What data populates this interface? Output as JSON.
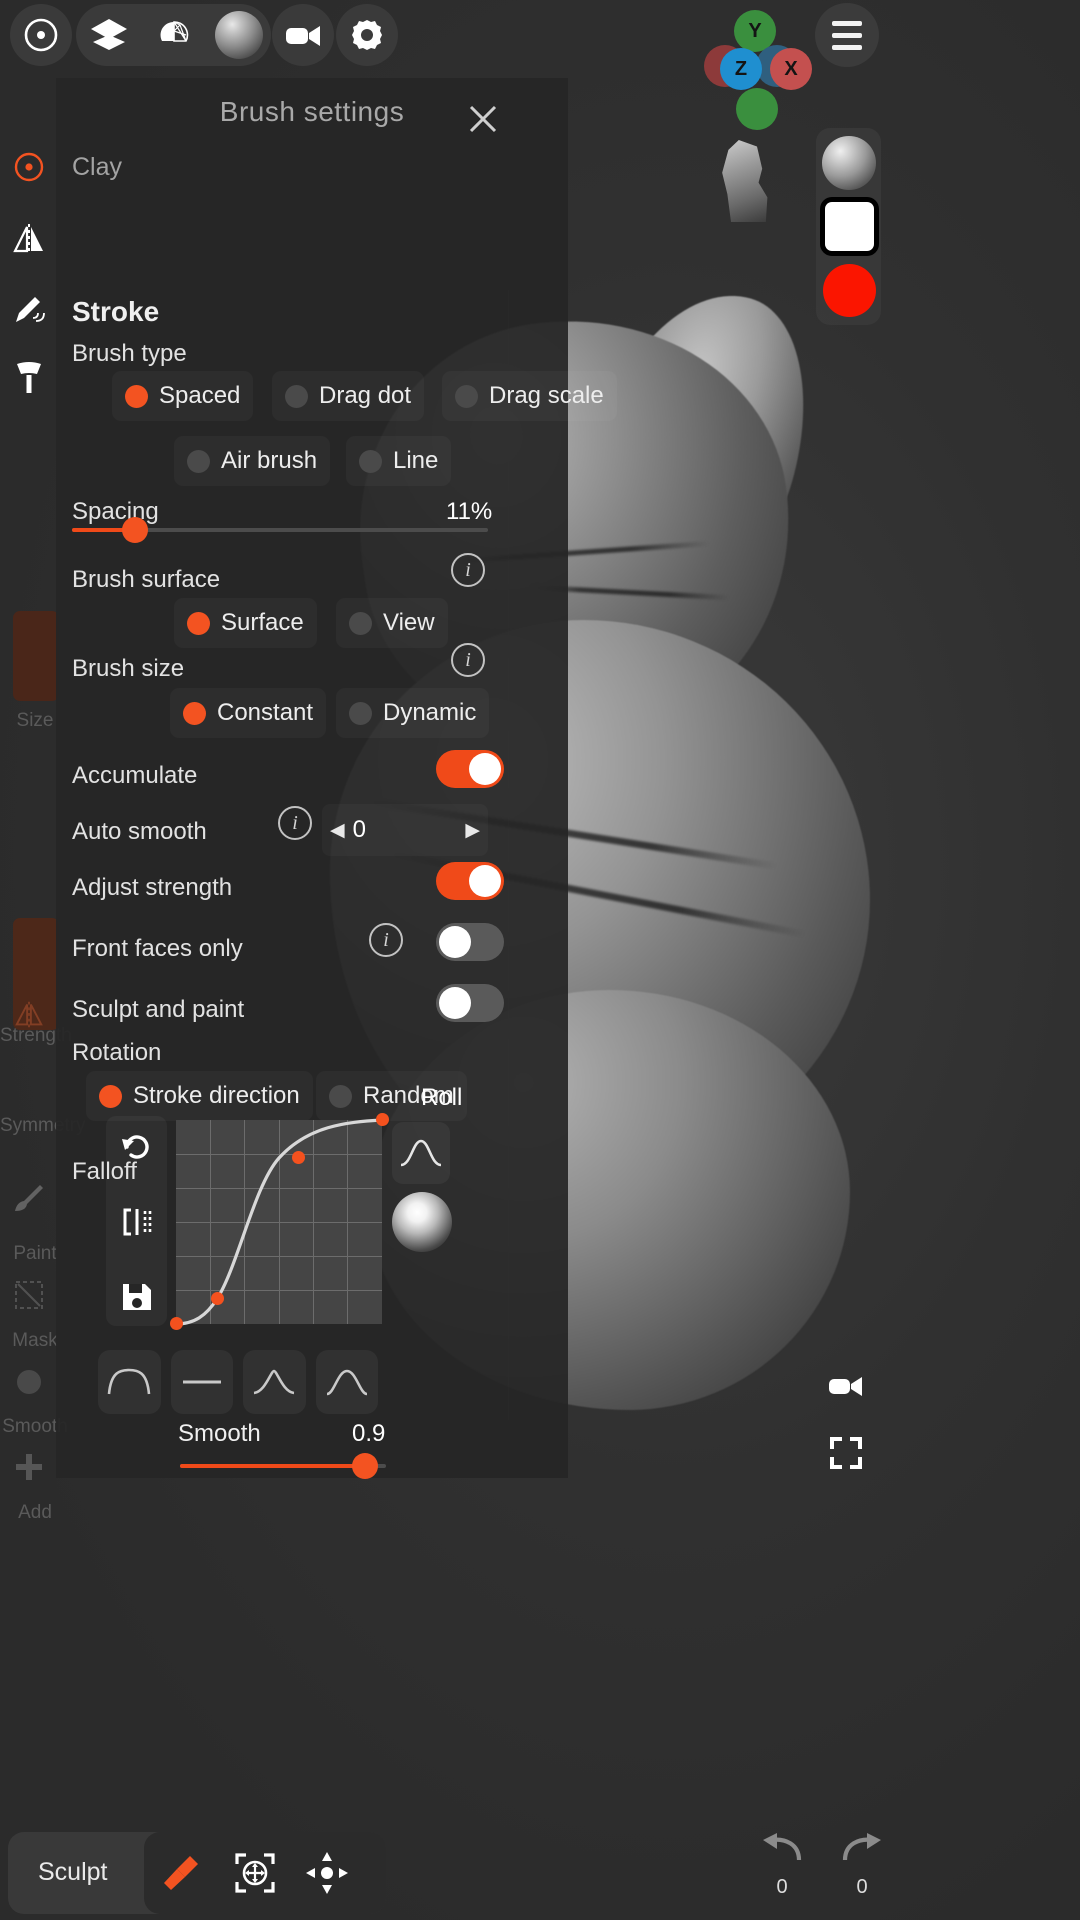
{
  "app": {
    "accent": "#f35321",
    "panel_bg": "#262626",
    "viewport_bg": "#2e2e2e"
  },
  "topbar": {
    "items": [
      {
        "name": "target-icon",
        "label": "Target"
      },
      {
        "name": "layers-icon",
        "label": "Layers"
      },
      {
        "name": "topology-icon",
        "label": "Topology"
      },
      {
        "name": "material-sphere-icon",
        "label": "Material"
      },
      {
        "name": "camera-icon",
        "label": "Camera"
      },
      {
        "name": "gear-icon",
        "label": "Settings"
      }
    ],
    "menu_label": "Menu"
  },
  "gizmo": {
    "axes": [
      {
        "label": "Y",
        "color": "#3a8f3e"
      },
      {
        "label": "Z",
        "color": "#1f8fd0"
      },
      {
        "label": "X",
        "color": "#c4504f"
      },
      {
        "label": "",
        "color": "#8d3a3a"
      },
      {
        "label": "",
        "color": "#2f5f7f"
      },
      {
        "label": "",
        "color": "#3a8f3e"
      }
    ]
  },
  "right_rail": {
    "material_label": "Material sphere",
    "swatch_white": "#ffffff",
    "swatch_red": "#fb1500"
  },
  "left_sidebar": {
    "items": [
      {
        "name": "brush-target-icon",
        "label": ""
      },
      {
        "name": "symmetry-icon",
        "label": ""
      },
      {
        "name": "pen-pressure-icon",
        "label": ""
      },
      {
        "name": "brush-tip-icon",
        "label": ""
      },
      {
        "name": "size-slider",
        "label": "Size"
      },
      {
        "name": "strength-slider",
        "label": "Strength"
      },
      {
        "name": "symmetry-toggle",
        "label": "Symmetry"
      },
      {
        "name": "paint-tool",
        "label": "Paint"
      },
      {
        "name": "mask-tool",
        "label": "Mask"
      },
      {
        "name": "smooth-tool",
        "label": "Smooth"
      },
      {
        "name": "add-tool",
        "label": "Add"
      }
    ]
  },
  "panel": {
    "title": "Brush settings",
    "close_label": "Close",
    "brush_name": "Clay",
    "section_stroke": "Stroke",
    "brush_type_label": "Brush type",
    "brush_type_options": [
      {
        "label": "Spaced",
        "selected": true
      },
      {
        "label": "Drag dot",
        "selected": false
      },
      {
        "label": "Drag scale",
        "selected": false
      },
      {
        "label": "Air brush",
        "selected": false
      },
      {
        "label": "Line",
        "selected": false
      }
    ],
    "spacing_label": "Spacing",
    "spacing_value": "11%",
    "spacing_percent": 11,
    "brush_surface_label": "Brush surface",
    "brush_surface_options": [
      {
        "label": "Surface",
        "selected": true
      },
      {
        "label": "View",
        "selected": false
      }
    ],
    "brush_size_label": "Brush size",
    "brush_size_options": [
      {
        "label": "Constant",
        "selected": true
      },
      {
        "label": "Dynamic",
        "selected": false
      }
    ],
    "accumulate_label": "Accumulate",
    "accumulate_on": true,
    "auto_smooth_label": "Auto smooth",
    "auto_smooth_value": "0",
    "adjust_strength_label": "Adjust strength",
    "adjust_strength_on": true,
    "front_faces_label": "Front faces only",
    "front_faces_on": false,
    "sculpt_and_paint_label": "Sculpt and paint",
    "sculpt_and_paint_on": false,
    "rotation_label": "Rotation",
    "rotation_options": [
      {
        "label": "Stroke direction",
        "selected": true
      },
      {
        "label": "Random",
        "selected": false
      }
    ],
    "roll_label": "Roll",
    "falloff_label": "Falloff",
    "curve_tools": [
      {
        "name": "reset-curve-icon",
        "label": "Reset"
      },
      {
        "name": "mirror-curve-icon",
        "label": "Mirror"
      },
      {
        "name": "save-curve-icon",
        "label": "Save"
      }
    ],
    "smooth_label": "Smooth",
    "smooth_value": "0.9",
    "smooth_percent": 90,
    "presets": [
      {
        "name": "preset-plateau"
      },
      {
        "name": "preset-flat"
      },
      {
        "name": "preset-spike"
      },
      {
        "name": "preset-dome"
      }
    ]
  },
  "chart_data": {
    "type": "line",
    "title": "Falloff",
    "xlabel": "",
    "ylabel": "",
    "xlim": [
      0,
      1
    ],
    "ylim": [
      0,
      1
    ],
    "grid": true,
    "legend": "none",
    "x": [
      0.0,
      0.2,
      0.6,
      1.0
    ],
    "y": [
      0.0,
      0.12,
      0.84,
      1.0
    ],
    "control_points": [
      {
        "x": 0.0,
        "y": 0.0
      },
      {
        "x": 0.2,
        "y": 0.12
      },
      {
        "x": 0.6,
        "y": 0.84
      },
      {
        "x": 1.0,
        "y": 1.0
      }
    ],
    "grid_cols": 6,
    "grid_rows": 6,
    "curve_color": "#d8d8d8",
    "point_color": "#f4511e"
  },
  "bottombar": {
    "mode_label": "Sculpt",
    "tools": [
      {
        "name": "brush-tool-icon",
        "label": "Brush",
        "active": true
      },
      {
        "name": "transform-icon",
        "label": "Transform",
        "active": false
      },
      {
        "name": "gizmo-move-icon",
        "label": "Move",
        "active": false
      }
    ]
  },
  "bottom_right": {
    "camera_label": "Camera",
    "fullscreen_label": "Fullscreen",
    "undo_count": "0",
    "redo_count": "0"
  }
}
